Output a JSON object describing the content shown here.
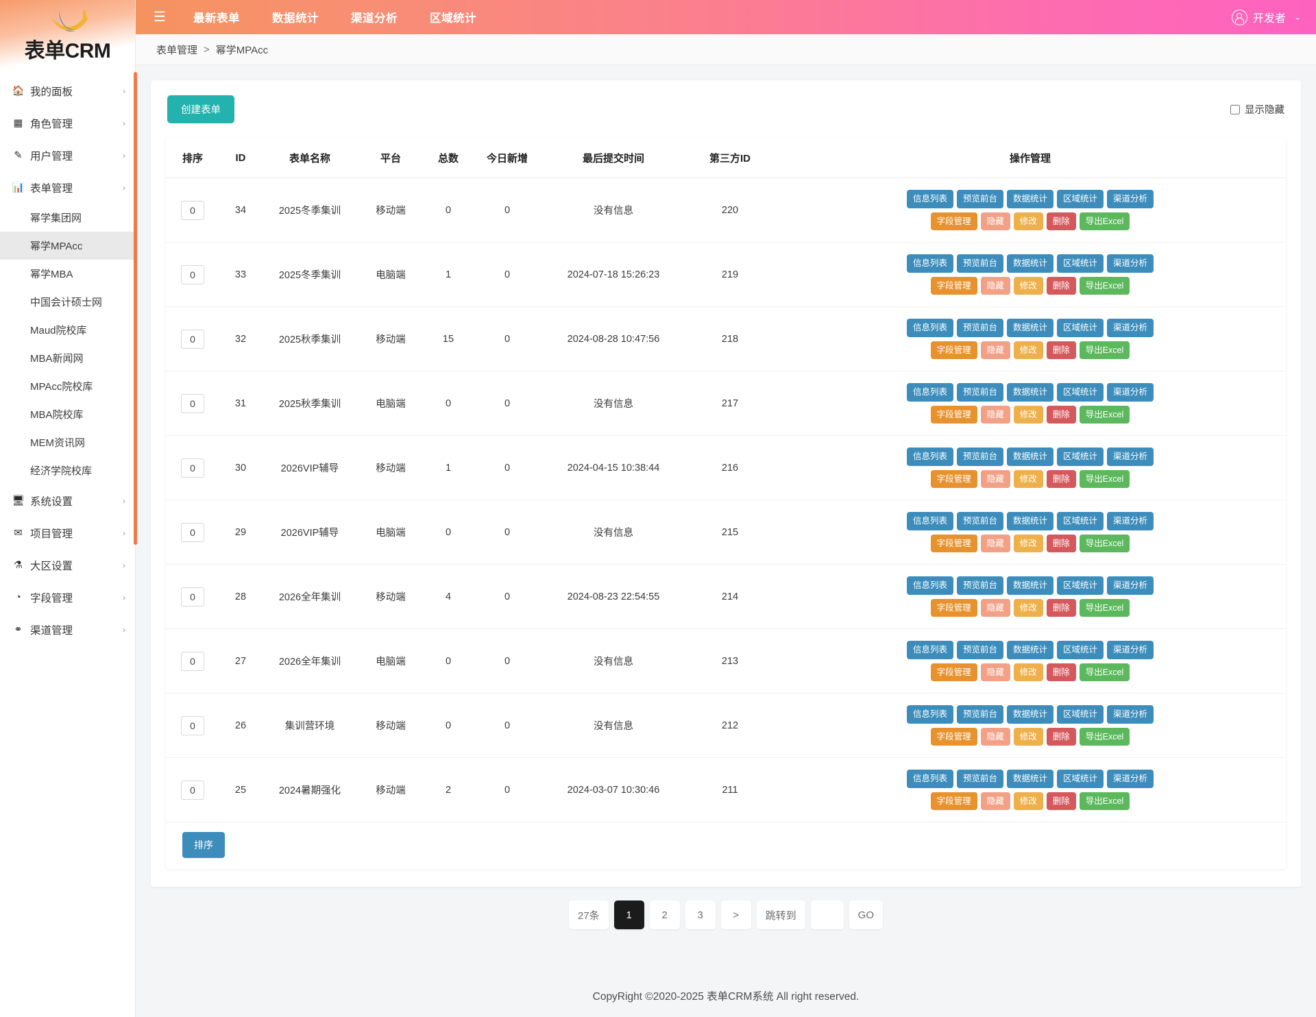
{
  "brand": {
    "name": "表单CRM",
    "logo_icon": "swoosh-logo-icon"
  },
  "topbar": {
    "menu_icon": "hamburger-menu-icon",
    "nav": [
      {
        "label": "最新表单"
      },
      {
        "label": "数据统计"
      },
      {
        "label": "渠道分析"
      },
      {
        "label": "区域统计"
      }
    ],
    "user": {
      "name": "开发者",
      "avatar_icon": "user-circle-icon",
      "caret_icon": "chevron-down-icon"
    }
  },
  "sidebar": {
    "groups": [
      {
        "icon": "home-icon",
        "label": "我的面板",
        "chevron": "›"
      },
      {
        "icon": "table-icon",
        "label": "角色管理",
        "chevron": "›"
      },
      {
        "icon": "edit-square-icon",
        "label": "用户管理",
        "chevron": "›"
      },
      {
        "icon": "bar-chart-icon",
        "label": "表单管理",
        "chevron": "›"
      }
    ],
    "sub_items": [
      {
        "label": "幂学集团网",
        "active": false
      },
      {
        "label": "幂学MPAcc",
        "active": true
      },
      {
        "label": "幂学MBA",
        "active": false
      },
      {
        "label": "中国会计硕士网",
        "active": false
      },
      {
        "label": "Maud院校库",
        "active": false
      },
      {
        "label": "MBA新闻网",
        "active": false
      },
      {
        "label": "MPAcc院校库",
        "active": false
      },
      {
        "label": "MBA院校库",
        "active": false
      },
      {
        "label": "MEM资讯网",
        "active": false
      },
      {
        "label": "经济学院校库",
        "active": false
      }
    ],
    "groups_bottom": [
      {
        "icon": "monitor-icon",
        "label": "系统设置",
        "chevron": "›"
      },
      {
        "icon": "envelope-icon",
        "label": "项目管理",
        "chevron": "›"
      },
      {
        "icon": "flask-icon",
        "label": "大区设置",
        "chevron": "›"
      },
      {
        "icon": "pie-chart-icon",
        "label": "字段管理",
        "chevron": "›"
      },
      {
        "icon": "share-icon",
        "label": "渠道管理",
        "chevron": "›"
      }
    ]
  },
  "breadcrumb": {
    "parent": "表单管理",
    "separator": ">",
    "current": "幂学MPAcc"
  },
  "toolbar": {
    "create_label": "创建表单",
    "show_hidden_label": "显示隐藏",
    "show_hidden_checked": false
  },
  "table": {
    "headers": [
      "排序",
      "ID",
      "表单名称",
      "平台",
      "总数",
      "今日新增",
      "最后提交时间",
      "第三方ID",
      "操作管理"
    ],
    "op_buttons_row1": [
      "信息列表",
      "预览前台",
      "数据统计",
      "区域统计",
      "渠道分析"
    ],
    "op_buttons_row2": [
      "字段管理",
      "隐藏",
      "修改",
      "删除",
      "导出Excel"
    ],
    "rows": [
      {
        "sort": "0",
        "id": "34",
        "name": "2025冬季集训",
        "platform": "移动端",
        "total": "0",
        "today": "0",
        "last_submit": "没有信息",
        "third_id": "220"
      },
      {
        "sort": "0",
        "id": "33",
        "name": "2025冬季集训",
        "platform": "电脑端",
        "total": "1",
        "today": "0",
        "last_submit": "2024-07-18 15:26:23",
        "third_id": "219"
      },
      {
        "sort": "0",
        "id": "32",
        "name": "2025秋季集训",
        "platform": "移动端",
        "total": "15",
        "today": "0",
        "last_submit": "2024-08-28 10:47:56",
        "third_id": "218"
      },
      {
        "sort": "0",
        "id": "31",
        "name": "2025秋季集训",
        "platform": "电脑端",
        "total": "0",
        "today": "0",
        "last_submit": "没有信息",
        "third_id": "217"
      },
      {
        "sort": "0",
        "id": "30",
        "name": "2026VIP辅导",
        "platform": "移动端",
        "total": "1",
        "today": "0",
        "last_submit": "2024-04-15 10:38:44",
        "third_id": "216"
      },
      {
        "sort": "0",
        "id": "29",
        "name": "2026VIP辅导",
        "platform": "电脑端",
        "total": "0",
        "today": "0",
        "last_submit": "没有信息",
        "third_id": "215"
      },
      {
        "sort": "0",
        "id": "28",
        "name": "2026全年集训",
        "platform": "移动端",
        "total": "4",
        "today": "0",
        "last_submit": "2024-08-23 22:54:55",
        "third_id": "214"
      },
      {
        "sort": "0",
        "id": "27",
        "name": "2026全年集训",
        "platform": "电脑端",
        "total": "0",
        "today": "0",
        "last_submit": "没有信息",
        "third_id": "213"
      },
      {
        "sort": "0",
        "id": "26",
        "name": "集训营环境",
        "platform": "移动端",
        "total": "0",
        "today": "0",
        "last_submit": "没有信息",
        "third_id": "212"
      },
      {
        "sort": "0",
        "id": "25",
        "name": "2024暑期强化",
        "platform": "移动端",
        "total": "2",
        "today": "0",
        "last_submit": "2024-03-07 10:30:46",
        "third_id": "211"
      }
    ],
    "sort_button_label": "排序"
  },
  "pagination": {
    "total_label": "27条",
    "pages": [
      "1",
      "2",
      "3"
    ],
    "active_page": "1",
    "next_label": ">",
    "jump_label": "跳转到",
    "jump_value": "",
    "go_label": "GO"
  },
  "footer": {
    "text": "CopyRight ©2020-2025 表单CRM系统 All right reserved."
  }
}
